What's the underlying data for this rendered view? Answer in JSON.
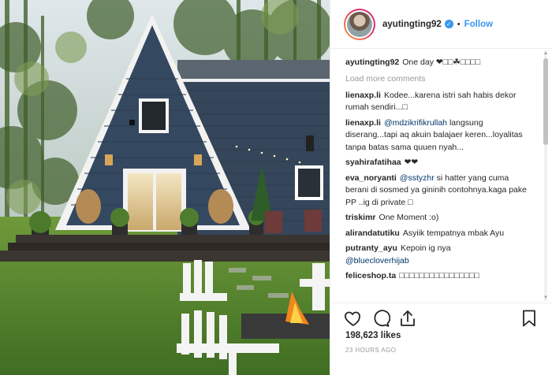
{
  "post": {
    "username": "ayutingting92",
    "verified_icon": "verified-check-icon",
    "separator": "•",
    "follow_label": "Follow"
  },
  "caption": {
    "username": "ayutingting92",
    "text": "One day ❤□□☘□□□□"
  },
  "load_more_label": "Load more comments",
  "comments": [
    {
      "user": "lienaxp.li",
      "mention": "",
      "text": "Kodee...karena istri sah habis dekor rumah sendiri...□"
    },
    {
      "user": "lienaxp.li",
      "mention": "@mdzikrifikrullah",
      "text": " langsung diserang...tapi aq akuin balajaer keren...loyalitas tanpa batas sama quuen nyah..."
    },
    {
      "user": "syahirafatihaa",
      "mention": "",
      "text": "❤❤"
    },
    {
      "user": "eva_noryanti",
      "mention": "@sstyzhr",
      "text": " si hatter yang cuma berani di sosmed ya gininih contohnya.kaga pake PP ..ig di private □"
    },
    {
      "user": "triskimr",
      "mention": "",
      "text": "One Moment :o)"
    },
    {
      "user": "alirandatutiku",
      "mention": "",
      "text": "Asyiik tempatnya mbak Ayu"
    },
    {
      "user": "putranty_ayu",
      "mention": "",
      "text": "Kepoin ig nya ",
      "mention_after": "@bluecloverhijab"
    },
    {
      "user": "feliceshop.ta",
      "mention": "",
      "text": "□□□□□□□□□□□□□□□□"
    }
  ],
  "likes_text": "198,623 likes",
  "time_ago": "23 HOURS AGO",
  "icons": {
    "like": "heart-icon",
    "comment": "comment-bubble-icon",
    "share": "share-upload-icon",
    "save": "bookmark-icon"
  },
  "colors": {
    "accent": "#3897f0",
    "text": "#262626",
    "muted": "#999999",
    "mention": "#003569"
  }
}
